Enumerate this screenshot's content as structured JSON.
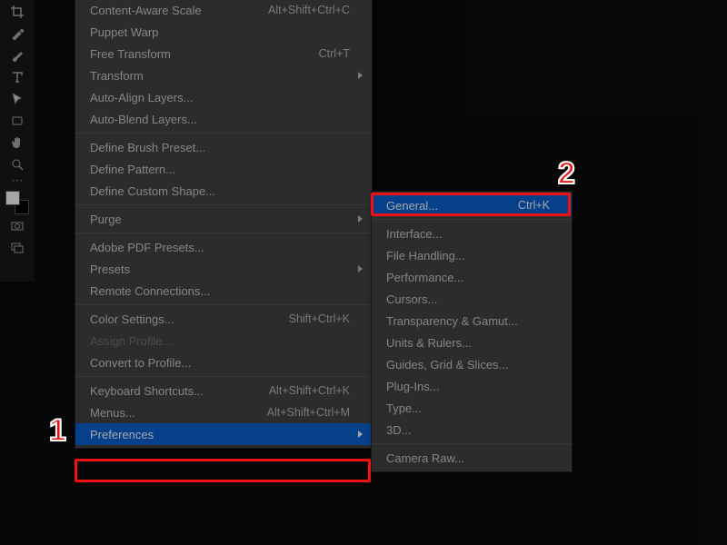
{
  "tools": [
    "crop",
    "eyedropper",
    "brush",
    "text",
    "arrow",
    "rect",
    "hand",
    "zoom"
  ],
  "main_menu": [
    {
      "label": "Content-Aware Scale",
      "shortcut": "Alt+Shift+Ctrl+C"
    },
    {
      "label": "Puppet Warp"
    },
    {
      "label": "Free Transform",
      "shortcut": "Ctrl+T"
    },
    {
      "label": "Transform",
      "submenu": true
    },
    {
      "label": "Auto-Align Layers..."
    },
    {
      "label": "Auto-Blend Layers..."
    },
    {
      "sep": true
    },
    {
      "label": "Define Brush Preset..."
    },
    {
      "label": "Define Pattern..."
    },
    {
      "label": "Define Custom Shape..."
    },
    {
      "sep": true
    },
    {
      "label": "Purge",
      "submenu": true
    },
    {
      "sep": true
    },
    {
      "label": "Adobe PDF Presets..."
    },
    {
      "label": "Presets",
      "submenu": true
    },
    {
      "label": "Remote Connections..."
    },
    {
      "sep": true
    },
    {
      "label": "Color Settings...",
      "shortcut": "Shift+Ctrl+K"
    },
    {
      "label": "Assign Profile...",
      "disabled": true
    },
    {
      "label": "Convert to Profile..."
    },
    {
      "sep": true
    },
    {
      "label": "Keyboard Shortcuts...",
      "shortcut": "Alt+Shift+Ctrl+K"
    },
    {
      "label": "Menus...",
      "shortcut": "Alt+Shift+Ctrl+M"
    },
    {
      "label": "Preferences",
      "submenu": true,
      "selected": true
    }
  ],
  "sub_menu": [
    {
      "label": "General...",
      "shortcut": "Ctrl+K",
      "selected": true
    },
    {
      "sep": true
    },
    {
      "label": "Interface..."
    },
    {
      "label": "File Handling..."
    },
    {
      "label": "Performance..."
    },
    {
      "label": "Cursors..."
    },
    {
      "label": "Transparency & Gamut..."
    },
    {
      "label": "Units & Rulers..."
    },
    {
      "label": "Guides, Grid & Slices..."
    },
    {
      "label": "Plug-Ins..."
    },
    {
      "label": "Type..."
    },
    {
      "label": "3D..."
    },
    {
      "sep": true
    },
    {
      "label": "Camera Raw..."
    }
  ],
  "annotations": {
    "n1": "1",
    "n2": "2"
  }
}
